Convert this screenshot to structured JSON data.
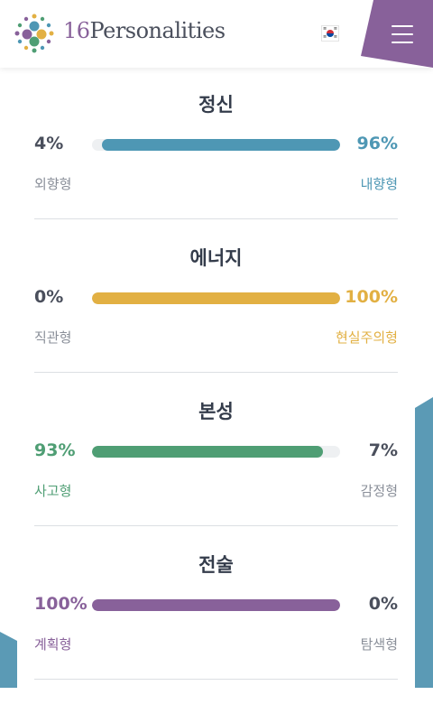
{
  "header": {
    "logo_number": "16",
    "logo_word": "Personalities",
    "flag_icon": "korea-flag-icon",
    "menu_icon": "hamburger-icon",
    "menu_color": "#88619a"
  },
  "traits": [
    {
      "title": "정신",
      "left_pct": "4%",
      "right_pct": "96%",
      "left_label": "외향형",
      "right_label": "내향형",
      "fill_side": "right",
      "fill_fraction": 0.96,
      "color": "#4e97b4",
      "highlight": "right"
    },
    {
      "title": "에너지",
      "left_pct": "0%",
      "right_pct": "100%",
      "left_label": "직관형",
      "right_label": "현실주의형",
      "fill_side": "right",
      "fill_fraction": 1.0,
      "color": "#e2b043",
      "highlight": "right"
    },
    {
      "title": "본성",
      "left_pct": "93%",
      "right_pct": "7%",
      "left_label": "사고형",
      "right_label": "감정형",
      "fill_side": "left",
      "fill_fraction": 0.93,
      "color": "#4f9e74",
      "highlight": "left"
    },
    {
      "title": "전술",
      "left_pct": "100%",
      "right_pct": "0%",
      "left_label": "계획형",
      "right_label": "탐색형",
      "fill_side": "left",
      "fill_fraction": 1.0,
      "color": "#88619a",
      "highlight": "left"
    }
  ]
}
